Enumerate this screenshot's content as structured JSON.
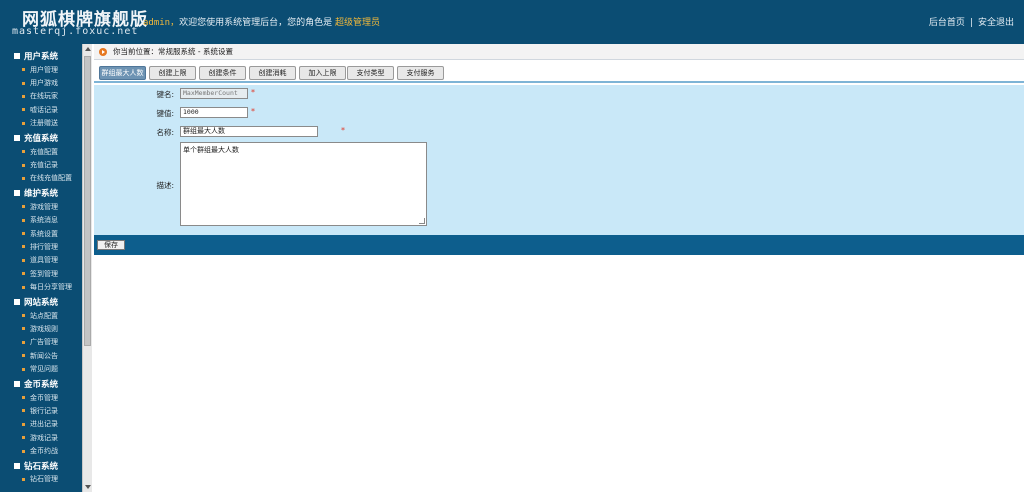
{
  "header": {
    "logo_title": "网狐棋牌旗舰版",
    "logo_sub": "masterqj.foxuc.net",
    "welcome_user": "admin，",
    "welcome_text": "欢迎您使用系统管理后台，您的角色是",
    "welcome_role": "超级管理员",
    "link_home": "后台首页",
    "link_sep": "|",
    "link_logout": "安全退出"
  },
  "sidebar": {
    "groups": [
      {
        "title": "用户系统",
        "items": [
          "用户管理",
          "用户游戏",
          "在线玩家",
          "嘘话记录",
          "注册赠送"
        ]
      },
      {
        "title": "充值系统",
        "items": [
          "充值配置",
          "充值记录",
          "在线充值配置"
        ]
      },
      {
        "title": "维护系统",
        "items": [
          "游戏管理",
          "系统消息",
          "系统设置",
          "排行管理",
          "道具管理",
          "签到管理",
          "每日分享管理"
        ]
      },
      {
        "title": "网站系统",
        "items": [
          "站点配置",
          "游戏规则",
          "广告管理",
          "新闻公告",
          "常见问题"
        ]
      },
      {
        "title": "金币系统",
        "items": [
          "金币管理",
          "银行记录",
          "进出记录",
          "游戏记录",
          "金币约战"
        ]
      },
      {
        "title": "钻石系统",
        "items": [
          "钻石管理"
        ]
      }
    ]
  },
  "breadcrumb": {
    "text": "你当前位置：常规服系统 - 系统设置"
  },
  "tabs": [
    {
      "label": "群组最大人数"
    },
    {
      "label": "创建上限"
    },
    {
      "label": "创建条件"
    },
    {
      "label": "创建消耗"
    },
    {
      "label": "加入上限"
    },
    {
      "label": "支付类型"
    },
    {
      "label": "支付服务"
    }
  ],
  "form": {
    "key_label": "键名:",
    "key_value": "MaxMemberCount",
    "value_label": "键值:",
    "value_value": "1000",
    "name_label": "名称:",
    "name_value": "群组最大人数",
    "desc_label": "描述:",
    "desc_value": "单个群组最大人数",
    "required_mark": "*"
  },
  "actions": {
    "save_label": "保存"
  },
  "colors": {
    "header_bg": "#0b4d73",
    "form_bg": "#c9e8f8",
    "save_bar_bg": "#0d5e8d",
    "active_tab": "#6d93b3",
    "accent_orange": "#f2b93b"
  }
}
